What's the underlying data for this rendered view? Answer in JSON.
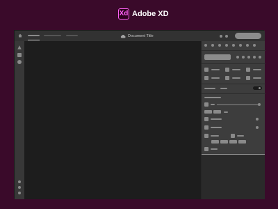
{
  "brand": {
    "logo_text": "Xd",
    "title": "Adobe XD",
    "accent_color": "#ff61f6",
    "background_color": "#3a0a2a"
  },
  "window": {
    "document_title": "Document Title",
    "icons": {
      "home": "home-icon",
      "cloud": "cloud-icon",
      "triangle_tool": "triangle-icon",
      "rectangle_tool": "rectangle-icon",
      "ellipse_tool": "ellipse-icon"
    }
  }
}
